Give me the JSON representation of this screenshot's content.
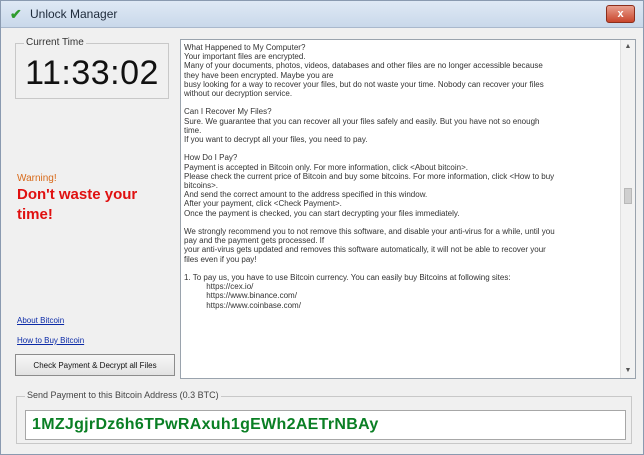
{
  "window": {
    "title": "Unlock Manager",
    "close_label": "x"
  },
  "timer": {
    "label": "Current Time",
    "value": "11:33:02"
  },
  "warning": {
    "label": "Warning!",
    "text": "Don't waste your time!"
  },
  "links": {
    "about_bitcoin": "About Bitcoin",
    "how_to_buy": "How to Buy Bitcoin"
  },
  "buttons": {
    "check_payment": "Check Payment & Decrypt all Files"
  },
  "message": {
    "text": "What Happened to My Computer?\nYour important files are encrypted.\nMany of your documents, photos, videos, databases and other files are no longer accessible because\nthey have been encrypted. Maybe you are\nbusy looking for a way to recover your files, but do not waste your time. Nobody can recover your files\nwithout our decryption service.\n\nCan I Recover My Files?\nSure. We guarantee that you can recover all your files safely and easily. But you have not so enough\ntime.\nIf you want to decrypt all your files, you need to pay.\n\nHow Do I Pay?\nPayment is accepted in Bitcoin only. For more information, click <About bitcoin>.\nPlease check the current price of Bitcoin and buy some bitcoins. For more information, click <How to buy\nbitcoins>.\nAnd send the correct amount to the address specified in this window.\nAfter your payment, click <Check Payment>.\nOnce the payment is checked, you can start decrypting your files immediately.\n\nWe strongly recommend you to not remove this software, and disable your anti-virus for a while, until you\npay and the payment gets processed. If\nyour anti-virus gets updated and removes this software automatically, it will not be able to recover your\nfiles even if you pay!\n\n1. To pay us, you have to use Bitcoin currency. You can easily buy Bitcoins at following sites:\n          https://cex.io/\n          https://www.binance.com/\n          https://www.coinbase.com/"
  },
  "payment": {
    "label": "Send Payment to this Bitcoin Address (0.3 BTC)",
    "address": "1MZJgjrDz6h6TPwRAxuh1gEWh2AETrNBAy"
  },
  "colors": {
    "warning_red": "#e01010",
    "address_green": "#0a7f24",
    "link_blue": "#0b2aa7"
  }
}
